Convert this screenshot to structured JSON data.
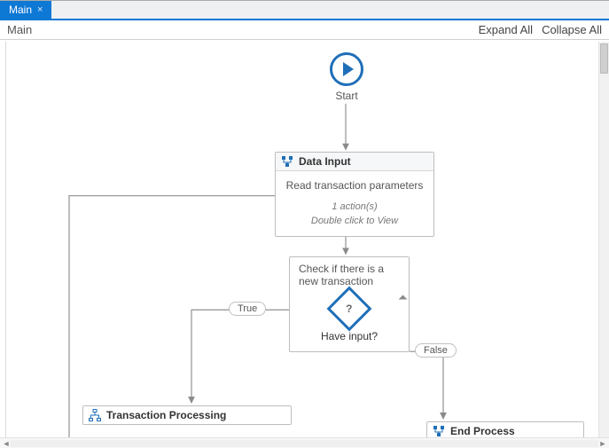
{
  "tab": {
    "title": "Main",
    "close_glyph": "×"
  },
  "breadcrumb": {
    "text": "Main"
  },
  "toolbar": {
    "expand": "Expand All",
    "collapse": "Collapse All"
  },
  "nodes": {
    "start": {
      "label": "Start"
    },
    "data_input": {
      "title": "Data Input",
      "desc": "Read transaction parameters",
      "meta1": "1 action(s)",
      "meta2": "Double click to View"
    },
    "decision": {
      "desc": "Check if there is a new transaction",
      "question_mark": "?",
      "caption": "Have input?"
    },
    "txn_processing": {
      "title": "Transaction Processing"
    },
    "end_process": {
      "title": "End Process"
    }
  },
  "branches": {
    "true": "True",
    "false": "False"
  },
  "scroll_glyphs": {
    "left": "◄",
    "right": "►"
  }
}
